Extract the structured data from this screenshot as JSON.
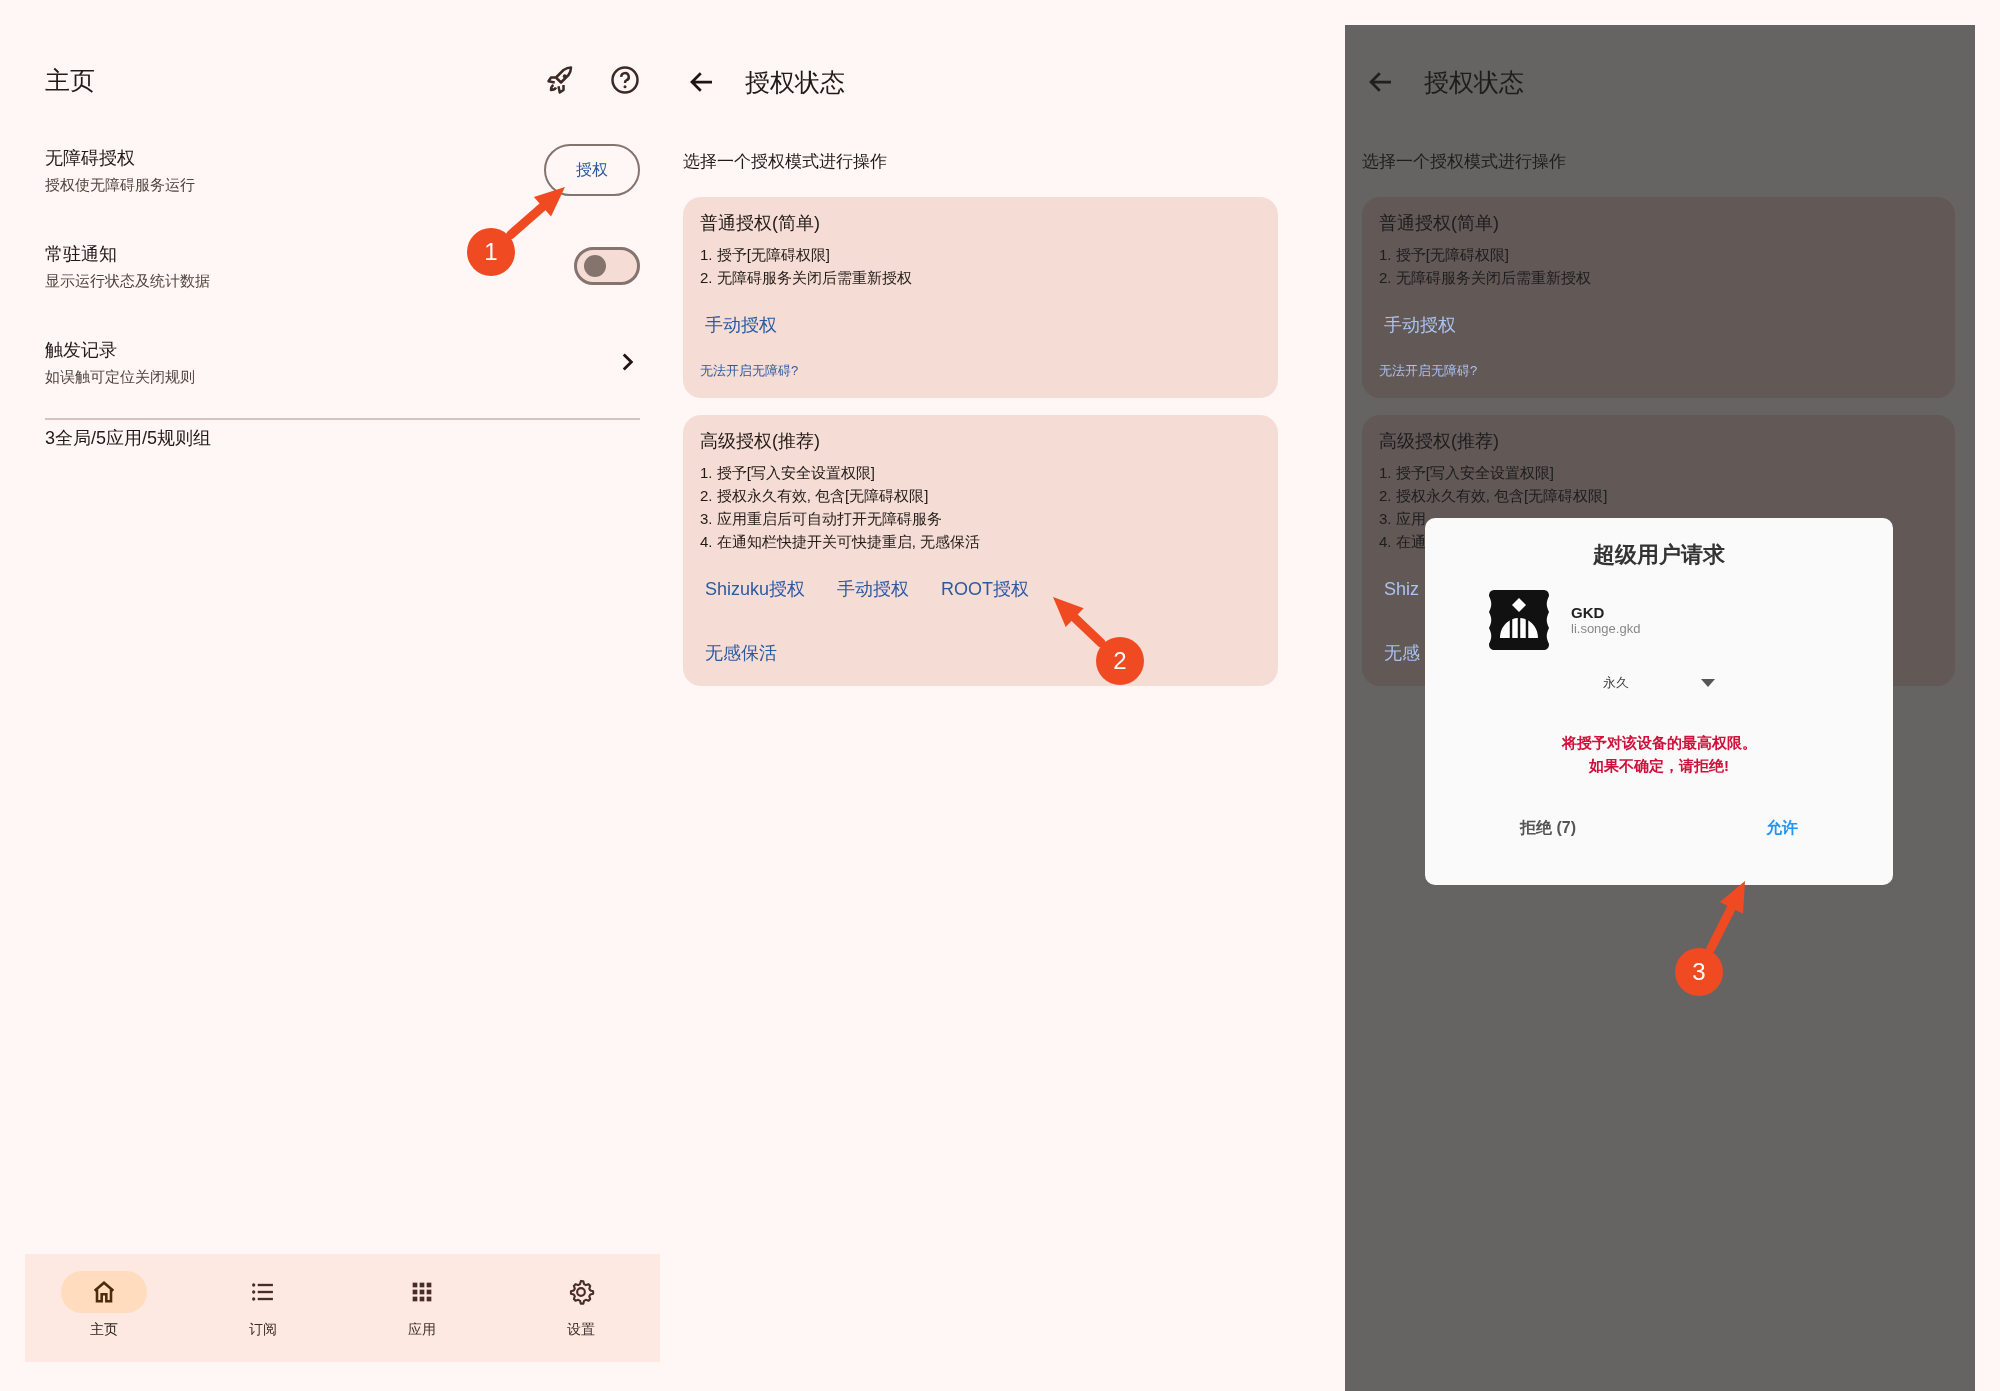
{
  "home": {
    "title": "主页",
    "rows": [
      {
        "kind": "button",
        "title": "无障碍授权",
        "subtitle": "授权使无障碍服务运行",
        "button": "授权"
      },
      {
        "kind": "switch",
        "title": "常驻通知",
        "subtitle": "显示运行状态及统计数据",
        "on": false
      },
      {
        "kind": "link",
        "title": "触发记录",
        "subtitle": "如误触可定位关闭规则"
      }
    ],
    "summary": "3全局/5应用/5规则组",
    "nav": [
      {
        "label": "主页",
        "selected": true
      },
      {
        "label": "订阅",
        "selected": false
      },
      {
        "label": "应用",
        "selected": false
      },
      {
        "label": "设置",
        "selected": false
      }
    ]
  },
  "auth": {
    "title": "授权状态",
    "prompt": "选择一个授权模式进行操作",
    "cards": [
      {
        "title": "普通授权(简单)",
        "items": [
          "1. 授予[无障碍权限]",
          "2. 无障碍服务关闭后需重新授权"
        ],
        "link_rows": [
          [
            "手动授权"
          ]
        ],
        "footnote": "无法开启无障碍?"
      },
      {
        "title": "高级授权(推荐)",
        "items": [
          "1. 授予[写入安全设置权限]",
          "2. 授权永久有效, 包含[无障碍权限]",
          "3. 应用重启后可自动打开无障碍服务",
          "4. 在通知栏快捷开关可快捷重启, 无感保活"
        ],
        "link_rows": [
          [
            "Shizuku授权",
            "手动授权",
            "ROOT授权"
          ],
          [
            "无感保活"
          ]
        ]
      }
    ]
  },
  "auth_dimmed": {
    "title": "授权状态",
    "prompt": "选择一个授权模式进行操作",
    "cards": [
      {
        "title": "普通授权(简单)",
        "items": [
          "1. 授予[无障碍权限]",
          "2. 无障碍服务关闭后需重新授权"
        ],
        "link_rows": [
          [
            "手动授权"
          ]
        ],
        "footnote": "无法开启无障碍?"
      },
      {
        "title": "高级授权(推荐)",
        "items": [
          "1. 授予[写入安全设置权限]",
          "2. 授权永久有效, 包含[无障碍权限]",
          "3. 应用",
          "4. 在通"
        ],
        "link_rows": [
          [
            "Shiz"
          ],
          [
            "无感"
          ]
        ]
      }
    ]
  },
  "dialog": {
    "title": "超级用户请求",
    "app_name": "GKD",
    "package": "li.songe.gkd",
    "duration": "永久",
    "warning": [
      "将授予对该设备的最高权限。",
      "如果不确定，请拒绝!"
    ],
    "deny": "拒绝 (7)",
    "allow": "允许"
  },
  "callouts": [
    {
      "number": "1"
    },
    {
      "number": "2"
    },
    {
      "number": "3"
    }
  ]
}
